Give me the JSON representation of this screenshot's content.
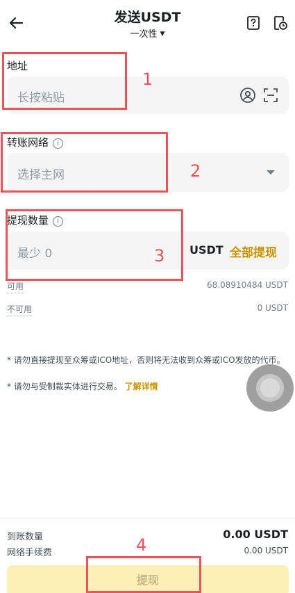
{
  "header": {
    "title": "发送USDT",
    "subtitle": "一次性",
    "back_icon": "arrow-left-icon",
    "help_icon": "help-square-icon",
    "history_icon": "document-clock-icon"
  },
  "address": {
    "label": "地址",
    "placeholder": "长按粘贴",
    "icons": [
      "address-book-icon",
      "scan-icon"
    ]
  },
  "network": {
    "label": "转账网络",
    "placeholder": "选择主网",
    "info_icon": "info-icon",
    "dropdown_icon": "caret-down-icon"
  },
  "amount": {
    "label": "提现数量",
    "placeholder": "最少 0",
    "unit": "USDT",
    "max_label": "全部提现",
    "info_icon": "info-icon"
  },
  "balances": {
    "available_label": "可用",
    "available_value": "68.08910484 USDT",
    "unavailable_label": "不可用",
    "unavailable_value": "0 USDT"
  },
  "notes": {
    "note1": "* 请勿直接提现至众筹或ICO地址，否则将无法收到众筹或ICO发放的代币。",
    "note2": "* 请勿与受制裁实体进行交易。",
    "note2_link": "了解详情"
  },
  "summary": {
    "receive_label": "到账数量",
    "receive_value": "0.00 USDT",
    "fee_label": "网络手续费",
    "fee_value": "0.00 USDT"
  },
  "submit_label": "提现",
  "annotations": [
    "1",
    "2",
    "3",
    "4"
  ],
  "colors": {
    "accent": "#c99400",
    "annotation": "#e8545a",
    "button_disabled": "#fdf0b6",
    "field_bg": "#f5f5f5"
  }
}
